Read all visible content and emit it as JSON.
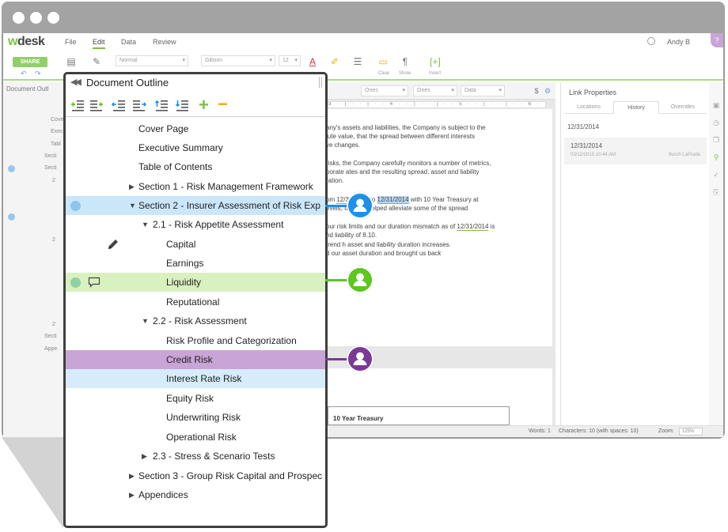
{
  "app": {
    "logo_w": "w",
    "logo_rest": "desk",
    "menu": [
      "File",
      "Edit",
      "Data",
      "Review"
    ],
    "active_menu": "Edit",
    "user": "Andy B",
    "help": "?"
  },
  "toolbar": {
    "share_label": "SHARE",
    "style_select": "Normal",
    "font_select": "Gibson",
    "size_select": "12",
    "clear_label": "Clear",
    "show_label": "Show",
    "insert_label": "Insert"
  },
  "left_panel": {
    "header": "Document Outl",
    "rows": [
      "Cove",
      "Exec",
      "Tabl",
      "Secti",
      "Secti",
      "2",
      "2",
      "2",
      "Secti",
      "Appe"
    ]
  },
  "doc_bar": {
    "select1": "Ones",
    "select2": "Ones",
    "select3": "Data",
    "currency": "$"
  },
  "ruler_text": "3 · | · · | · · 4 · · | · · | · · 5 · · | · · | · · 6 · · | · · | · · 7 · · | · ·",
  "document": {
    "p1_l1": "any's assets and liabilities, the Company is subject to the",
    "p1_l2": "lute value, that the spread between different interests",
    "p1_l3": "ve changes.",
    "p2_l1": "risks, the Company carefully monitors a number of metrics,",
    "p2_l2": "porate       ates and the resulting spread, asset and liability",
    "p2_l3": "ration.",
    "p3_l1_pre": "om ",
    "p3_date1": "12/31/2013",
    "p3_mid": " to ",
    "p3_date2": "12/31/2014",
    "p3_l1_post": " with 10 Year Treasury at",
    "p3_l2": "evels, this has helped alleviate some of the spread",
    "p4_l1_pre": "our risk limits and our duration mismatch as of ",
    "p4_date": "12/31/2014",
    "p4_l1_post": " is",
    "p4_l2": "nd liability of 8.10.",
    "p4_l3": "trend        h asset and liability duration increases.",
    "p4_l4": "d our asset duration and brought us back",
    "table_heading": "10 Year Treasury"
  },
  "link_properties": {
    "title": "Link Properties",
    "tabs": [
      "Locations",
      "History",
      "Overrides"
    ],
    "active_tab": "History",
    "date": "12/31/2014",
    "card_date": "12/31/2014",
    "card_timestamp": "03/12/2015 10:44 AM",
    "card_user": "Burch LaPrade"
  },
  "statusbar": {
    "words": "Words: 1",
    "characters": "Characters: 10 (with spaces: 10)",
    "zoom_label": "Zoom:",
    "zoom_value": "125%"
  },
  "outline": {
    "title": "Document Outline",
    "rows": [
      {
        "label": "Cover Page"
      },
      {
        "label": "Executive Summary"
      },
      {
        "label": "Table of Contents"
      },
      {
        "label": "Section 1 - Risk Management Framework",
        "caret": "▶"
      },
      {
        "label": "Section 2 - Insurer Assessment of Risk Exp",
        "caret": "▼"
      },
      {
        "label": "2.1 - Risk Appetite Assessment",
        "caret": "▼"
      },
      {
        "label": "Capital"
      },
      {
        "label": "Earnings"
      },
      {
        "label": "Liquidity"
      },
      {
        "label": "Reputational"
      },
      {
        "label": "2.2 - Risk Assessment",
        "caret": "▼"
      },
      {
        "label": "Risk Profile and Categorization"
      },
      {
        "label": "Credit Risk"
      },
      {
        "label": "Interest Rate Risk"
      },
      {
        "label": "Equity Risk"
      },
      {
        "label": "Underwriting Risk"
      },
      {
        "label": "Operational Risk"
      },
      {
        "label": "2.3 - Stress & Scenario Tests",
        "caret": "▶"
      },
      {
        "label": "Section 3 - Group Risk Capital and Prospec",
        "caret": "▶"
      },
      {
        "label": "Appendices",
        "caret": "▶"
      }
    ]
  },
  "colors": {
    "brand_green": "#7cc242",
    "user_blue": "#1e90e8",
    "user_green": "#5ec61f",
    "user_purple": "#7b3a96",
    "highlight_blue": "#cbe6f8",
    "highlight_green": "#d9f1bf",
    "highlight_purple": "#c9a4d6"
  }
}
